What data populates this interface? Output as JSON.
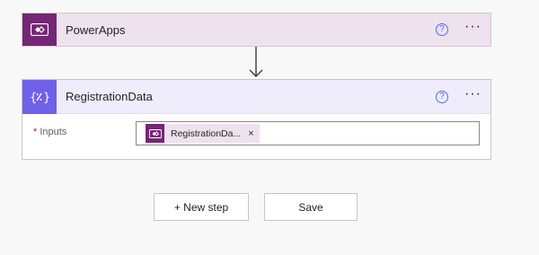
{
  "trigger": {
    "title": "PowerApps",
    "icon": "powerapps-icon",
    "color": "#742774",
    "help": "?",
    "more": "···"
  },
  "action": {
    "title": "RegistrationData",
    "icon": "variable-icon",
    "color": "#7160e8",
    "help": "?",
    "more": "···",
    "field": {
      "required_mark": "*",
      "label": "Inputs",
      "token": {
        "text": "RegistrationDa...",
        "remove": "×",
        "icon": "powerapps-icon"
      }
    }
  },
  "buttons": {
    "new_step": "+ New step",
    "save": "Save"
  }
}
